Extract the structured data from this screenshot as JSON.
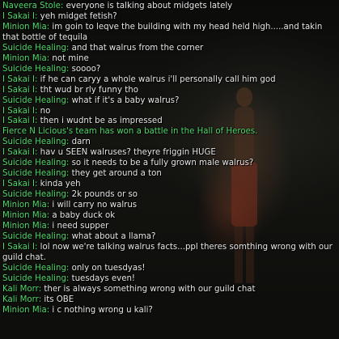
{
  "chat": {
    "lines": [
      {
        "speaker": "Naveera Stole",
        "text": " everyone is talking about midgets lately"
      },
      {
        "speaker": "I Sakai I",
        "text": " yeh midget fetish?"
      },
      {
        "speaker": "Minion Mia",
        "text": " im goin to leqve the building with my head held high.....and takin that bottle of tequila"
      },
      {
        "speaker": "Suicide Healing",
        "text": " and that walrus from the corner"
      },
      {
        "speaker": "Minion Mia",
        "text": " not mine"
      },
      {
        "speaker": "Suicide Healing",
        "text": " soooo?"
      },
      {
        "speaker": "I Sakai I",
        "text": " if he can caryy a whole walrus i'll personally call him god"
      },
      {
        "speaker": "I Sakai I",
        "text": " tht wud br rly funny tho"
      },
      {
        "speaker": "Suicide Healing",
        "text": " what if it's a baby walrus?"
      },
      {
        "speaker": "I Sakai I",
        "text": " no"
      },
      {
        "speaker": "I Sakai I",
        "text": " then i wudnt be as impressed"
      },
      {
        "system": "Fierce N Licious's team has won a battle in the Hall of Heroes."
      },
      {
        "speaker": "Suicide Healing",
        "text": " darn"
      },
      {
        "speaker": "I Sakai I",
        "text": " hav u SEEN walruses? theyre friggin HUGE"
      },
      {
        "speaker": "Suicide Healing",
        "text": " so it needs to be a fully grown male walrus?"
      },
      {
        "speaker": "Suicide Healing",
        "text": " they get around a ton"
      },
      {
        "speaker": "I Sakai I",
        "text": " kinda yeh"
      },
      {
        "speaker": "Suicide Healing",
        "text": " 2k pounds or so"
      },
      {
        "speaker": "Minion Mia",
        "text": " i will carry no walrus"
      },
      {
        "speaker": "Minion Mia",
        "text": " a baby duck ok"
      },
      {
        "speaker": "Minion Mia",
        "text": " i need supper"
      },
      {
        "speaker": "Suicide Healing",
        "text": " what about a llama?"
      },
      {
        "speaker": "I Sakai I",
        "text": " lol now we're talking walrus facts...ppl theres somthing wrong with our guild chat."
      },
      {
        "speaker": "Suicide Healing",
        "text": " only on tuesdyas!"
      },
      {
        "speaker": "Suicide Healing",
        "text": " tuesdays even!"
      },
      {
        "speaker": "Kali Morr",
        "text": " ther is always something wrong with our guild chat"
      },
      {
        "speaker": "Kali Morr",
        "text": " its OBE"
      },
      {
        "speaker": "Minion Mia",
        "text": " i c nothing wrong u kali?"
      }
    ]
  },
  "colors": {
    "speaker": "#4fd86a",
    "message": "#e6e6e6",
    "system": "#4fd86a",
    "background": "#000000"
  }
}
